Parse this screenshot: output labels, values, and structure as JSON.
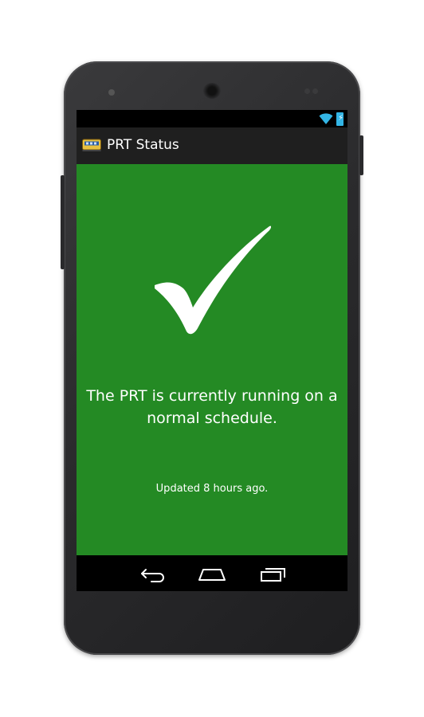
{
  "device": {
    "frame_color": "#2b2b2d"
  },
  "status_bar": {
    "wifi_icon": "wifi-icon",
    "battery_icon": "battery-charging-icon",
    "accent_color": "#33b5e5"
  },
  "action_bar": {
    "app_icon": "prt-train-icon",
    "title": "PRT Status"
  },
  "main": {
    "background_color": "#248a24",
    "status_icon": "checkmark-icon",
    "status_message": "The PRT is currently running on a normal schedule.",
    "updated_text": "Updated 8 hours ago."
  },
  "nav_bar": {
    "back_icon": "back-icon",
    "home_icon": "home-icon",
    "recents_icon": "recents-icon"
  }
}
